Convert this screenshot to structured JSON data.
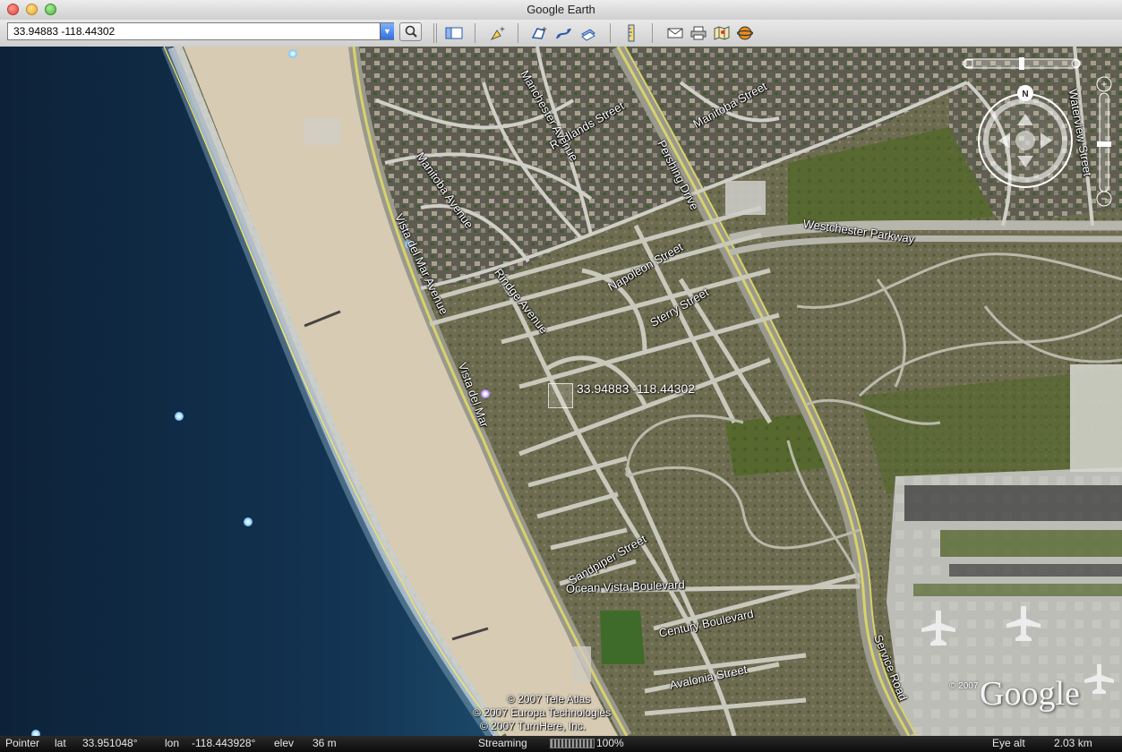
{
  "window": {
    "title": "Google Earth"
  },
  "search": {
    "value": "33.94883 -118.44302"
  },
  "toolbar": {
    "icons": [
      "sidebar-toggle-icon",
      "add-placemark-icon",
      "add-polygon-icon",
      "add-path-icon",
      "add-image-overlay-icon",
      "ruler-icon",
      "email-icon",
      "print-icon",
      "view-in-maps-icon",
      "sky-icon"
    ]
  },
  "map": {
    "placemark_label": "33.94883 -118.44302",
    "streets": [
      "Manitoba Street",
      "Redlands Street",
      "Pershing Drive",
      "Westchester Parkway",
      "Napoleon Street",
      "Sterry Street",
      "Rindge Avenue",
      "Vista del Mar Avenue",
      "Vista del Mar",
      "Manitoba Avenue",
      "Manchester Avenue",
      "Sandpiper Street",
      "Ocean Vista Boulevard",
      "Century Boulevard",
      "Avalonia Street",
      "Service Road",
      "Waterview Street"
    ],
    "copyright": [
      "© 2007 Tele Atlas",
      "© 2007 Europa Technologies",
      "© 2007 TurnHere, Inc."
    ],
    "logo_copyright": "© 2007",
    "logo": "Google"
  },
  "nav": {
    "north_label": "N",
    "zoom_in": "+",
    "zoom_out": "−"
  },
  "status": {
    "pointer_label": "Pointer",
    "lat_label": "lat",
    "lat_value": "33.951048°",
    "lon_label": "lon",
    "lon_value": "-118.443928°",
    "elev_label": "elev",
    "elev_value": "36 m",
    "streaming_label": "Streaming",
    "streaming_percent": "100%",
    "eye_alt_label": "Eye alt",
    "eye_alt_value": "2.03 km"
  },
  "colors": {
    "ocean": "#0f2a44",
    "sand": "#d8cbb3",
    "road": "#d9d26a",
    "terrain": "#6b6a4a"
  }
}
